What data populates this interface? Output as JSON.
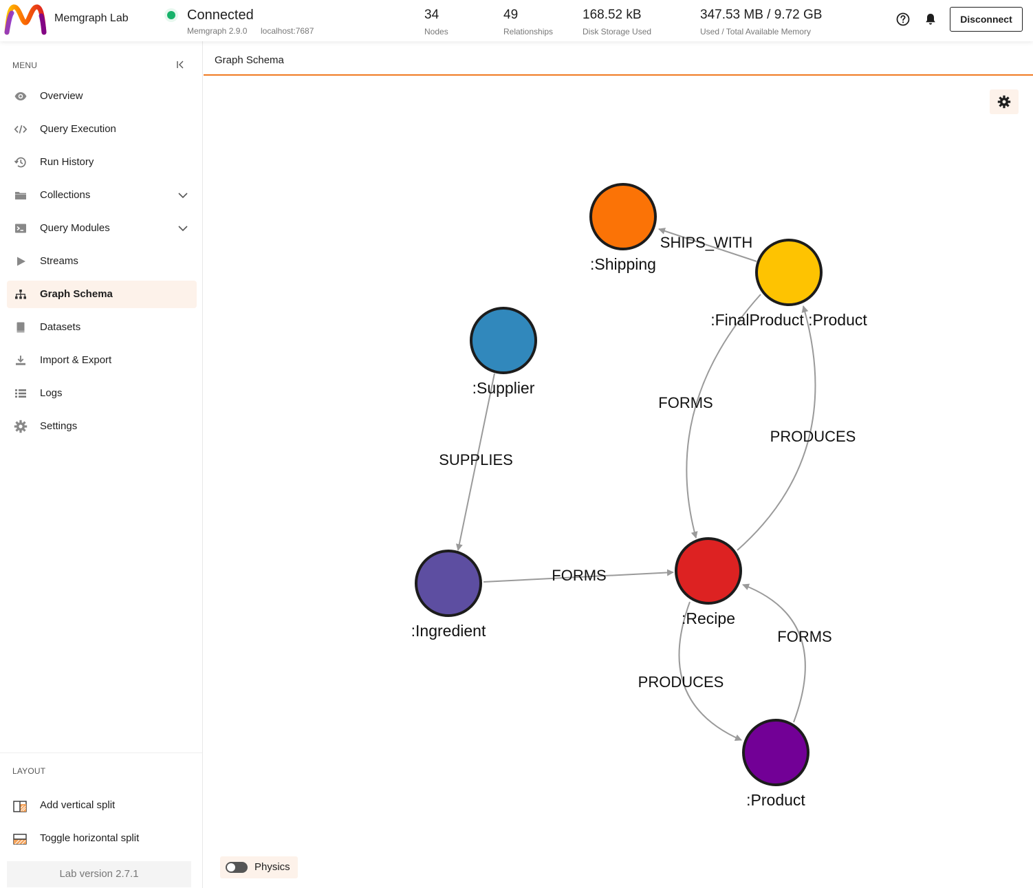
{
  "header": {
    "app_name": "Memgraph Lab",
    "status": "Connected",
    "version": "Memgraph 2.9.0",
    "host": "localhost:7687",
    "stats": [
      {
        "value": "34",
        "label": "Nodes"
      },
      {
        "value": "49",
        "label": "Relationships"
      },
      {
        "value": "168.52 kB",
        "label": "Disk Storage Used"
      },
      {
        "value": "347.53 MB / 9.72 GB",
        "label": "Used / Total Available Memory"
      }
    ],
    "help_icon": "help-circle-icon",
    "notification_icon": "bell-icon",
    "disconnect_label": "Disconnect",
    "status_color": "#17b26a"
  },
  "sidebar": {
    "menu_label": "MENU",
    "items": [
      {
        "label": "Overview",
        "icon": "eye-icon"
      },
      {
        "label": "Query Execution",
        "icon": "code-icon"
      },
      {
        "label": "Run History",
        "icon": "history-icon"
      },
      {
        "label": "Collections",
        "icon": "folder-icon",
        "expandable": true
      },
      {
        "label": "Query Modules",
        "icon": "terminal-icon",
        "expandable": true
      },
      {
        "label": "Streams",
        "icon": "play-icon"
      },
      {
        "label": "Graph Schema",
        "icon": "hierarchy-icon",
        "active": true
      },
      {
        "label": "Datasets",
        "icon": "book-icon"
      },
      {
        "label": "Import & Export",
        "icon": "download-icon"
      },
      {
        "label": "Logs",
        "icon": "list-icon"
      },
      {
        "label": "Settings",
        "icon": "gear-icon"
      }
    ],
    "layout_label": "LAYOUT",
    "layout_items": [
      {
        "label": "Add vertical split",
        "icon": "vertical-split-icon"
      },
      {
        "label": "Toggle horizontal split",
        "icon": "horizontal-split-icon"
      }
    ],
    "lab_version": "Lab version 2.7.1"
  },
  "main": {
    "tab_title": "Graph Schema",
    "physics_label": "Physics",
    "physics_enabled": false,
    "accent_color": "#f07a21"
  },
  "graph": {
    "nodes": [
      {
        "id": "shipping",
        "label": ":Shipping",
        "color": "#fb7306"
      },
      {
        "id": "finalproduct",
        "label": ":FinalProduct :Product",
        "color": "#fec301"
      },
      {
        "id": "supplier",
        "label": ":Supplier",
        "color": "#3188bc"
      },
      {
        "id": "ingredient",
        "label": ":Ingredient",
        "color": "#5d4ea1"
      },
      {
        "id": "recipe",
        "label": ":Recipe",
        "color": "#dd2222"
      },
      {
        "id": "product",
        "label": ":Product",
        "color": "#720096"
      }
    ],
    "edges": [
      {
        "id": "e-ships",
        "label": "SHIPS_WITH",
        "from": "finalproduct",
        "to": "shipping"
      },
      {
        "id": "e-forms-fp",
        "label": "FORMS",
        "from": "finalproduct",
        "to": "recipe"
      },
      {
        "id": "e-produces-fp",
        "label": "PRODUCES",
        "from": "recipe",
        "to": "finalproduct"
      },
      {
        "id": "e-supplies",
        "label": "SUPPLIES",
        "from": "supplier",
        "to": "ingredient"
      },
      {
        "id": "e-forms-ing",
        "label": "FORMS",
        "from": "ingredient",
        "to": "recipe"
      },
      {
        "id": "e-forms-prod",
        "label": "FORMS",
        "from": "product",
        "to": "recipe"
      },
      {
        "id": "e-produces-prod",
        "label": "PRODUCES",
        "from": "recipe",
        "to": "product"
      }
    ]
  }
}
